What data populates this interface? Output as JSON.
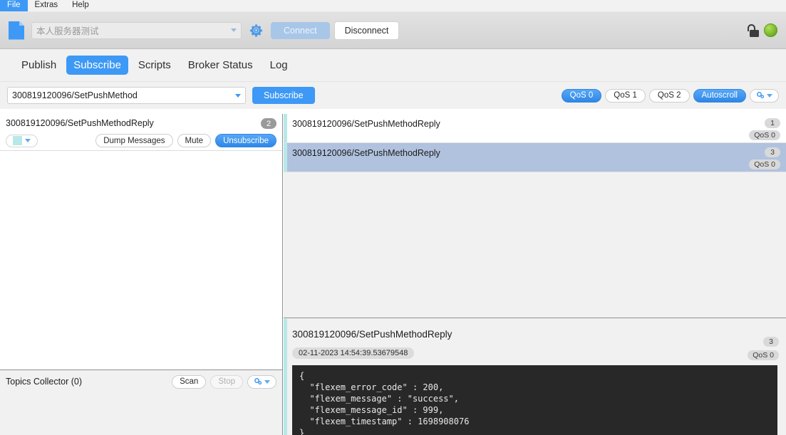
{
  "menubar": {
    "items": [
      {
        "label": "File",
        "active": true
      },
      {
        "label": "Extras",
        "active": false
      },
      {
        "label": "Help",
        "active": false
      }
    ]
  },
  "connection_bar": {
    "profile_placeholder": "本人服务器测试",
    "profile_value": "",
    "settings_icon": "gear-icon",
    "connect_label": "Connect",
    "disconnect_label": "Disconnect",
    "lock_icon": "unlocked-padlock-icon",
    "status_icon": "green-status-led",
    "status_color": "#74b327"
  },
  "tabs": [
    {
      "label": "Publish",
      "active": false
    },
    {
      "label": "Subscribe",
      "active": true
    },
    {
      "label": "Scripts",
      "active": false
    },
    {
      "label": "Broker Status",
      "active": false
    },
    {
      "label": "Log",
      "active": false
    }
  ],
  "subscribe_bar": {
    "topic_value": "300819120096/SetPushMethod",
    "topic_placeholder": "Topic",
    "subscribe_label": "Subscribe",
    "qos_options": [
      {
        "label": "QoS 0",
        "selected": true
      },
      {
        "label": "QoS 1",
        "selected": false
      },
      {
        "label": "QoS 2",
        "selected": false
      }
    ],
    "autoscroll_label": "Autoscroll",
    "autoscroll_on": true,
    "options_icon": "gears-dropdown-icon"
  },
  "subscriptions": {
    "entry": {
      "topic": "300819120096/SetPushMethodReply",
      "count": "2",
      "color_swatch": "#b9e8e8",
      "buttons": {
        "dump": "Dump Messages",
        "mute": "Mute",
        "unsubscribe": "Unsubscribe"
      }
    }
  },
  "topics_collector": {
    "title": "Topics Collector (0)",
    "scan_label": "Scan",
    "stop_label": "Stop",
    "options_icon": "gears-dropdown-icon"
  },
  "messages": [
    {
      "topic": "300819120096/SetPushMethodReply",
      "index": "1",
      "qos": "QoS 0",
      "selected": false
    },
    {
      "topic": "300819120096/SetPushMethodReply",
      "index": "3",
      "qos": "QoS 0",
      "selected": true
    }
  ],
  "detail": {
    "topic": "300819120096/SetPushMethodReply",
    "timestamp": "02-11-2023 14:54:39.53679548",
    "index": "3",
    "qos": "QoS 0",
    "payload": "{\n  \"flexem_error_code\" : 200,\n  \"flexem_message\" : \"success\",\n  \"flexem_message_id\" : 999,\n  \"flexem_timestamp\" : 1698908076\n}"
  },
  "colors": {
    "accent": "#3d99f5",
    "selected_row": "#b0c2de",
    "topic_color": "#b9e8e8",
    "payload_bg": "#282828"
  }
}
